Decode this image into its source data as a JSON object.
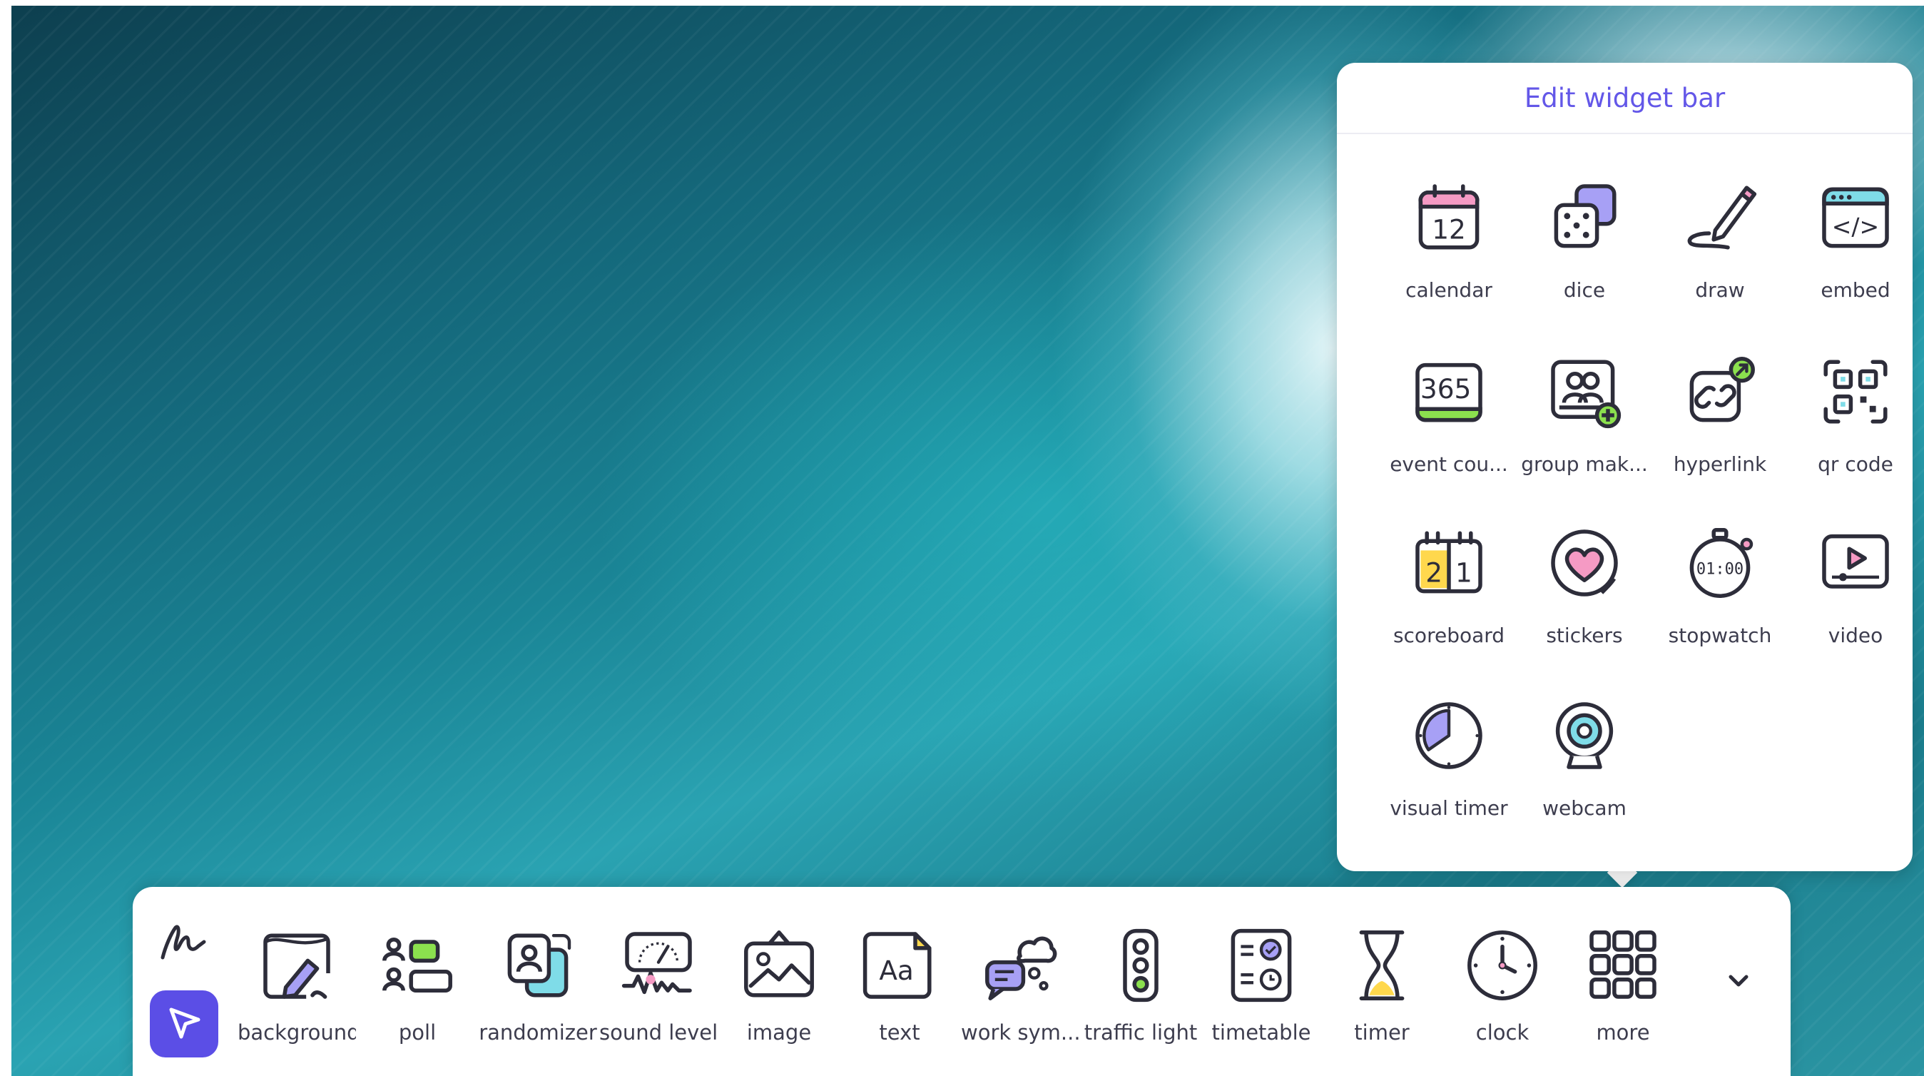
{
  "panel": {
    "title": "Edit widget bar",
    "widgets": [
      {
        "label": "calendar",
        "icon": "calendar-icon",
        "text": "12"
      },
      {
        "label": "dice",
        "icon": "dice-icon"
      },
      {
        "label": "draw",
        "icon": "pencil-draw-icon"
      },
      {
        "label": "embed",
        "icon": "embed-code-icon",
        "text": "</>"
      },
      {
        "label": "event cou...",
        "icon": "event-countdown-icon",
        "text": "365"
      },
      {
        "label": "group mak...",
        "icon": "group-maker-icon"
      },
      {
        "label": "hyperlink",
        "icon": "hyperlink-icon"
      },
      {
        "label": "qr code",
        "icon": "qr-code-icon"
      },
      {
        "label": "scoreboard",
        "icon": "scoreboard-icon",
        "text_left": "2",
        "text_right": "1"
      },
      {
        "label": "stickers",
        "icon": "heart-sticker-icon"
      },
      {
        "label": "stopwatch",
        "icon": "stopwatch-icon",
        "text": "01:00"
      },
      {
        "label": "video",
        "icon": "video-play-icon"
      },
      {
        "label": "visual timer",
        "icon": "visual-timer-icon"
      },
      {
        "label": "webcam",
        "icon": "webcam-icon"
      }
    ]
  },
  "toolbar": {
    "pen_icon": "pen-scribble-icon",
    "select_icon": "cursor-arrow-icon",
    "tools": [
      {
        "label": "background",
        "icon": "background-edit-icon"
      },
      {
        "label": "poll",
        "icon": "poll-icon"
      },
      {
        "label": "randomizer",
        "icon": "randomizer-icon"
      },
      {
        "label": "sound level",
        "icon": "sound-level-icon"
      },
      {
        "label": "image",
        "icon": "image-icon"
      },
      {
        "label": "text",
        "icon": "text-icon",
        "text": "Aa"
      },
      {
        "label": "work sym...",
        "icon": "work-symbols-icon"
      },
      {
        "label": "traffic light",
        "icon": "traffic-light-icon"
      },
      {
        "label": "timetable",
        "icon": "timetable-icon"
      },
      {
        "label": "timer",
        "icon": "hourglass-icon"
      },
      {
        "label": "clock",
        "icon": "clock-icon"
      },
      {
        "label": "more",
        "icon": "grid-more-icon"
      }
    ],
    "expand_icon": "chevron-down-icon"
  },
  "colors": {
    "accent": "#5b4ee6",
    "title": "#6357e8",
    "outline": "#2d2d3a",
    "pink": "#f59ac4",
    "cyan": "#7fdce8",
    "lavender": "#a7a0f5",
    "green": "#8be04e",
    "yellow": "#ffd84d"
  }
}
